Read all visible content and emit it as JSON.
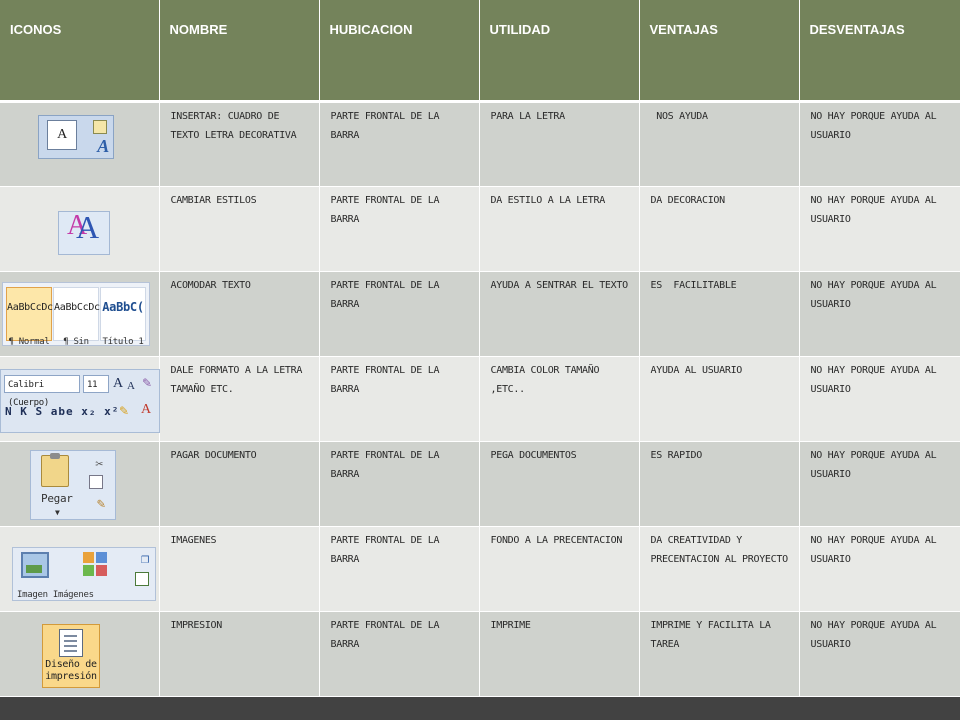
{
  "headers": [
    "ICONOS",
    "NOMBRE",
    "HUBICACION",
    "UTILIDAD",
    "VENTAJAS",
    "DESVENTAJAS"
  ],
  "rows": [
    {
      "icon": "textbox-wordart-icon",
      "nombre": "INSERTAR: CUADRO DE TEXTO LETRA DECORATIVA",
      "hubicacion": "PARTE FRONTAL DE LA BARRA",
      "utilidad": "PARA LA LETRA",
      "ventajas": " NOS AYUDA",
      "desventajas": "NO HAY PORQUE AYUDA AL USUARIO"
    },
    {
      "icon": "change-styles-icon",
      "nombre": "CAMBIAR ESTILOS",
      "hubicacion": "PARTE FRONTAL DE LA BARRA",
      "utilidad": "DA ESTILO A LA LETRA",
      "ventajas": "DA DECORACION",
      "desventajas": "NO HAY PORQUE AYUDA AL USUARIO"
    },
    {
      "icon": "style-gallery-icon",
      "nombre": "ACOMODAR TEXTO",
      "hubicacion": "PARTE FRONTAL DE LA BARRA",
      "utilidad": "AYUDA A SENTRAR EL TEXTO",
      "ventajas": "ES  FACILITABLE",
      "desventajas": "NO HAY PORQUE AYUDA AL USUARIO"
    },
    {
      "icon": "font-group-icon",
      "nombre": "DALE FORMATO A LA LETRA TAMAÑO ETC.",
      "hubicacion": "PARTE FRONTAL DE LA BARRA",
      "utilidad": "CAMBIA COLOR TAMAÑO ,ETC..",
      "ventajas": "AYUDA AL USUARIO",
      "desventajas": "NO HAY PORQUE AYUDA AL USUARIO"
    },
    {
      "icon": "paste-icon",
      "nombre": "PAGAR DOCUMENTO",
      "hubicacion": "PARTE FRONTAL DE LA BARRA",
      "utilidad": "PEGA DOCUMENTOS",
      "ventajas": "ES RAPIDO",
      "desventajas": "NO HAY PORQUE AYUDA AL USUARIO"
    },
    {
      "icon": "images-icon",
      "nombre": "IMAGENES",
      "hubicacion": "PARTE FRONTAL DE LA BARRA",
      "utilidad": "FONDO A LA PRECENTACION",
      "ventajas": "DA CREATIVIDAD Y PRECENTACION AL PROYECTO",
      "desventajas": "NO HAY PORQUE AYUDA AL USUARIO"
    },
    {
      "icon": "print-layout-icon",
      "nombre": "IMPRESION",
      "hubicacion": "PARTE FRONTAL DE LA BARRA",
      "utilidad": "IMPRIME",
      "ventajas": "IMPRIME Y FACILITA LA TAREA",
      "desventajas": "NO HAY PORQUE AYUDA AL USUARIO"
    }
  ],
  "icon_text": {
    "gallery": {
      "swatch1_sample": "AaBbCcDc",
      "swatch1_name": "¶ Normal",
      "swatch2_sample": "AaBbCcDc",
      "swatch2_name": "¶ Sin espa...",
      "swatch3_sample": "AaBbC(",
      "swatch3_name": "Título 1"
    },
    "font": {
      "font_name": "Calibri (Cuerpo)",
      "font_size": "11",
      "format_buttons": "N K S abe x₂ x²"
    },
    "paste": {
      "label": "Pegar"
    },
    "images": {
      "caption": "Imagen   Imágenes"
    },
    "print": {
      "label": "Diseño de impresión"
    }
  },
  "colors": {
    "header_bg": "#74835b",
    "row_odd_bg": "#cfd2cd",
    "row_even_bg": "#e8e9e6",
    "frame_bg": "#3d3d3d"
  }
}
